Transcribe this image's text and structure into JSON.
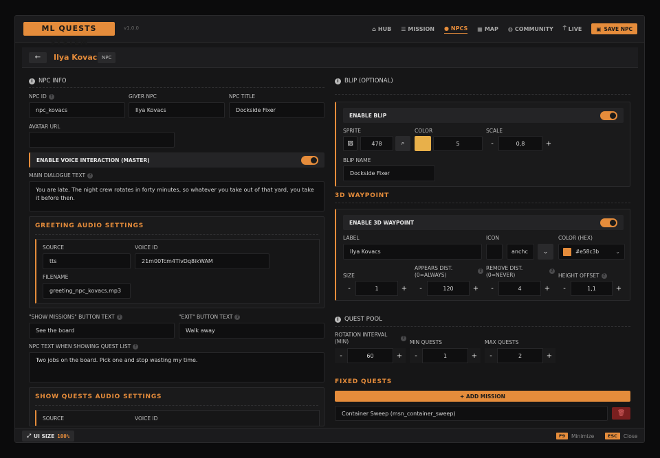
{
  "app": {
    "title": "ML QUESTS SYSTEM",
    "version": "v1.0.0"
  },
  "nav": [
    {
      "label": "HUB",
      "icon": "home-icon"
    },
    {
      "label": "MISSION",
      "icon": "list-icon"
    },
    {
      "label": "NPCS",
      "icon": "person-icon",
      "active": true
    },
    {
      "label": "MAP",
      "icon": "map-icon"
    },
    {
      "label": "COMMUNITY",
      "icon": "globe-icon"
    },
    {
      "label": "LIVE",
      "icon": "antenna-icon"
    }
  ],
  "save_label": "SAVE NPC",
  "header": {
    "back": "←",
    "name": "Ilya Kovacs",
    "tag": "NPC"
  },
  "npc_info": {
    "title": "NPC INFO",
    "npc_id_label": "NPC ID",
    "npc_id": "npc_kovacs",
    "giver_label": "GIVER NPC",
    "giver": "Ilya Kovacs",
    "npc_title_label": "NPC TITLE",
    "npc_title": "Dockside Fixer",
    "avatar_label": "AVATAR URL",
    "avatar": "",
    "voice_toggle": "ENABLE VOICE INTERACTION (MASTER)",
    "dialogue_label": "MAIN DIALOGUE TEXT",
    "dialogue": "You are late. The night crew rotates in forty minutes, so whatever you take out of that yard, you take it before then."
  },
  "greeting_audio": {
    "title": "GREETING AUDIO SETTINGS",
    "source_label": "SOURCE",
    "source": "tts",
    "voice_label": "VOICE ID",
    "voice": "21m00Tcm4TlvDq8ikWAM",
    "filename_label": "FILENAME",
    "filename": "greeting_npc_kovacs.mp3"
  },
  "buttons": {
    "show_label": "\"SHOW MISSIONS\" BUTTON TEXT",
    "show": "See the board",
    "exit_label": "\"EXIT\" BUTTON TEXT",
    "exit": "Walk away",
    "list_label": "NPC TEXT WHEN SHOWING QUEST LIST",
    "list": "Two jobs on the board. Pick one and stop wasting my time."
  },
  "quests_audio": {
    "title": "SHOW QUESTS AUDIO SETTINGS",
    "source_label": "SOURCE",
    "voice_label": "VOICE ID"
  },
  "blip": {
    "title": "BLIP (OPTIONAL)",
    "enable": "ENABLE BLIP",
    "sprite_label": "SPRITE",
    "sprite": "478",
    "color_label": "COLOR",
    "color": "5",
    "color_swatch": "#e8b04a",
    "scale_label": "SCALE",
    "scale": "0,8",
    "name_label": "BLIP NAME",
    "name": "Dockside Fixer"
  },
  "waypoint": {
    "title": "3D WAYPOINT",
    "enable": "ENABLE 3D WAYPOINT",
    "label_label": "LABEL",
    "label": "Ilya Kovacs",
    "icon_label": "ICON",
    "icon_value": "anchc",
    "color_label": "COLOR (HEX)",
    "color": "#e58c3b",
    "size_label": "SIZE",
    "size": "1",
    "appears_label1": "APPEARS DIST.",
    "appears_label2": "(0=ALWAYS)",
    "appears": "120",
    "remove_label1": "REMOVE DIST.",
    "remove_label2": "(0=NEVER)",
    "remove": "4",
    "height_label": "HEIGHT OFFSET",
    "height": "1,1"
  },
  "quest_pool": {
    "title": "QUEST POOL",
    "rotation_label1": "ROTATION INTERVAL",
    "rotation_label2": "(MIN)",
    "rotation": "60",
    "min_label": "MIN QUESTS",
    "min": "1",
    "max_label": "MAX QUESTS",
    "max": "2"
  },
  "fixed": {
    "title": "FIXED QUESTS",
    "add": "+ ADD MISSION",
    "items": [
      "Container Sweep (msn_container_sweep)"
    ]
  },
  "footer": {
    "ui_size_label": "UI SIZE",
    "ui_size": "100%",
    "minimize_key": "F9",
    "minimize": "Minimize",
    "close_key": "ESC",
    "close": "Close"
  },
  "colors": {
    "accent": "#e58c3b",
    "danger": "#7a1f1f"
  }
}
